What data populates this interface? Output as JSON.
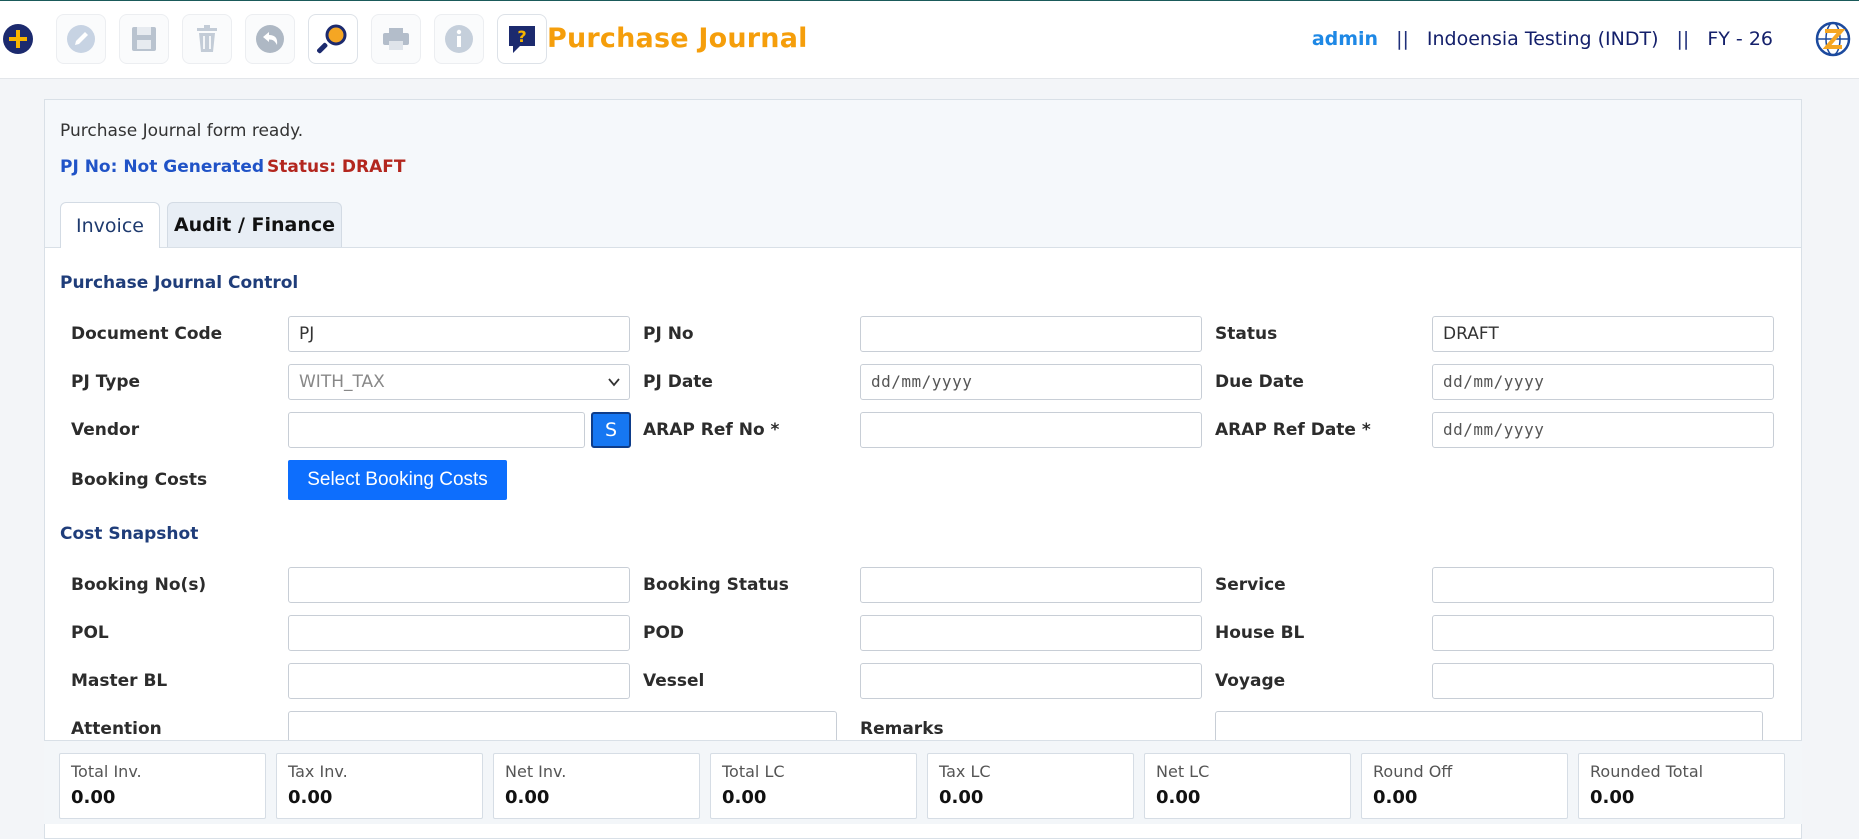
{
  "toolbar": {
    "buttons": [
      {
        "name": "new-button",
        "icon": "plus-circle-icon"
      },
      {
        "name": "edit-button",
        "icon": "pencil-icon"
      },
      {
        "name": "save-button",
        "icon": "floppy-disk-icon"
      },
      {
        "name": "delete-button",
        "icon": "trash-icon"
      },
      {
        "name": "undo-button",
        "icon": "undo-arrow-icon"
      },
      {
        "name": "search-button",
        "icon": "magnifier-icon"
      },
      {
        "name": "print-button",
        "icon": "printer-icon"
      },
      {
        "name": "info-button",
        "icon": "info-icon"
      },
      {
        "name": "help-button",
        "icon": "question-chat-icon"
      }
    ],
    "title": "Purchase Journal",
    "colors": {
      "title": "#f59e0b",
      "accent": "#1e88e5",
      "navy": "#14206b"
    }
  },
  "header": {
    "user": "admin",
    "separator": "||",
    "company": "Indoensia Testing (INDT)",
    "fiscal_year": "FY - 26"
  },
  "message": {
    "text": "Purchase Journal form ready.",
    "pj_no": "PJ No: Not Generated",
    "status": "Status: DRAFT"
  },
  "tabs": [
    {
      "label": "Invoice",
      "active": true
    },
    {
      "label": "Audit / Finance",
      "active": false
    }
  ],
  "control": {
    "section_title": "Purchase Journal Control",
    "document_code": {
      "label": "Document Code",
      "value": "PJ"
    },
    "pj_no": {
      "label": "PJ No",
      "value": ""
    },
    "status": {
      "label": "Status",
      "value": "DRAFT"
    },
    "pj_type": {
      "label": "PJ Type",
      "value": "WITH_TAX"
    },
    "pj_date": {
      "label": "PJ Date",
      "placeholder": "dd/mm/yyyy"
    },
    "due_date": {
      "label": "Due Date",
      "placeholder": "dd/mm/yyyy"
    },
    "vendor": {
      "label": "Vendor",
      "value": "",
      "button": "S"
    },
    "arap_ref_no": {
      "label": "ARAP Ref No *",
      "value": ""
    },
    "arap_ref_date": {
      "label": "ARAP Ref Date *",
      "placeholder": "dd/mm/yyyy"
    },
    "booking_costs": {
      "label": "Booking Costs",
      "button": "Select Booking Costs"
    }
  },
  "snapshot": {
    "section_title": "Cost Snapshot",
    "booking_nos": {
      "label": "Booking No(s)",
      "value": ""
    },
    "booking_status": {
      "label": "Booking Status",
      "value": ""
    },
    "service": {
      "label": "Service",
      "value": ""
    },
    "pol": {
      "label": "POL",
      "value": ""
    },
    "pod": {
      "label": "POD",
      "value": ""
    },
    "house_bl": {
      "label": "House BL",
      "value": ""
    },
    "master_bl": {
      "label": "Master BL",
      "value": ""
    },
    "vessel": {
      "label": "Vessel",
      "value": ""
    },
    "voyage": {
      "label": "Voyage",
      "value": ""
    },
    "attention": {
      "label": "Attention",
      "value": ""
    },
    "remarks": {
      "label": "Remarks",
      "value": ""
    }
  },
  "totals": [
    {
      "label": "Total Inv.",
      "value": "0.00"
    },
    {
      "label": "Tax Inv.",
      "value": "0.00"
    },
    {
      "label": "Net Inv.",
      "value": "0.00"
    },
    {
      "label": "Total LC",
      "value": "0.00"
    },
    {
      "label": "Tax LC",
      "value": "0.00"
    },
    {
      "label": "Net LC",
      "value": "0.00"
    },
    {
      "label": "Round Off",
      "value": "0.00"
    },
    {
      "label": "Rounded Total",
      "value": "0.00"
    }
  ]
}
